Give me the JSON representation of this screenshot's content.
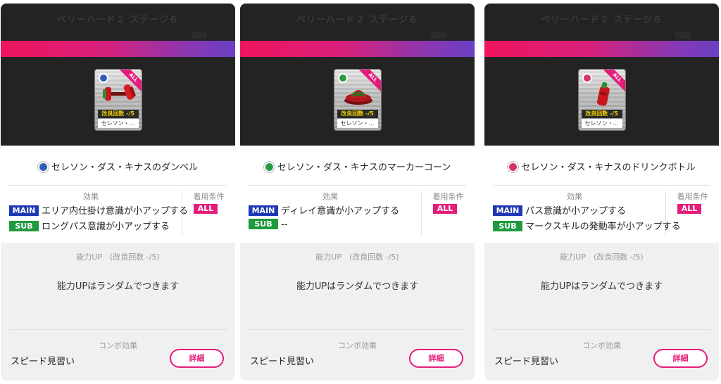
{
  "cards": [
    {
      "stage": "ベリーハード２ ステージ６",
      "card_tag": "ALL",
      "card_count": "改良回数 -/5",
      "card_name": "セレソン・...",
      "name": "セレソン・ダス・キナスのダンベル",
      "icon": "shirt-blue-icon",
      "icon_color": "#2d5fb8",
      "effect_heading": "効果",
      "main_tag": "MAIN",
      "main_text": "エリア内仕掛け意識が小アップする",
      "sub_tag": "SUB",
      "sub_text": "ロングパス意識が小アップする",
      "cond_heading": "着用条件",
      "cond_value": "ALL",
      "ability_heading": "能力UP　(改良回数 -/5)",
      "ability_text": "能力UPはランダムでつきます",
      "combo_heading": "コンボ効果",
      "combo_value": "スピード見習い",
      "detail_label": "詳細"
    },
    {
      "stage": "ベリーハード２ ステージ６",
      "card_tag": "ALL",
      "card_count": "改良回数 -/5",
      "card_name": "セレソン・...",
      "name": "セレソン・ダス・キナスのマーカーコーン",
      "icon": "shirt-green-icon",
      "icon_color": "#2a9b44",
      "effect_heading": "効果",
      "main_tag": "MAIN",
      "main_text": "ディレイ意識が小アップする",
      "sub_tag": "SUB",
      "sub_text": "--",
      "cond_heading": "着用条件",
      "cond_value": "ALL",
      "ability_heading": "能力UP　(改良回数 -/5)",
      "ability_text": "能力UPはランダムでつきます",
      "combo_heading": "コンボ効果",
      "combo_value": "スピード見習い",
      "detail_label": "詳細"
    },
    {
      "stage": "ベリーハード２ ステージ６",
      "card_tag": "ALL",
      "card_count": "改良回数 -/5",
      "card_name": "セレソン・...",
      "name": "セレソン・ダス・キナスのドリンクボトル",
      "icon": "shirt-pink-icon",
      "icon_color": "#d8336a",
      "effect_heading": "効果",
      "main_tag": "MAIN",
      "main_text": "パス意識が小アップする",
      "sub_tag": "SUB",
      "sub_text": "マークスキルの発動率が小アップする",
      "cond_heading": "着用条件",
      "cond_value": "ALL",
      "ability_heading": "能力UP　(改良回数 -/5)",
      "ability_text": "能力UPはランダムでつきます",
      "combo_heading": "コンボ効果",
      "combo_value": "スピード見習い",
      "detail_label": "詳細"
    }
  ]
}
